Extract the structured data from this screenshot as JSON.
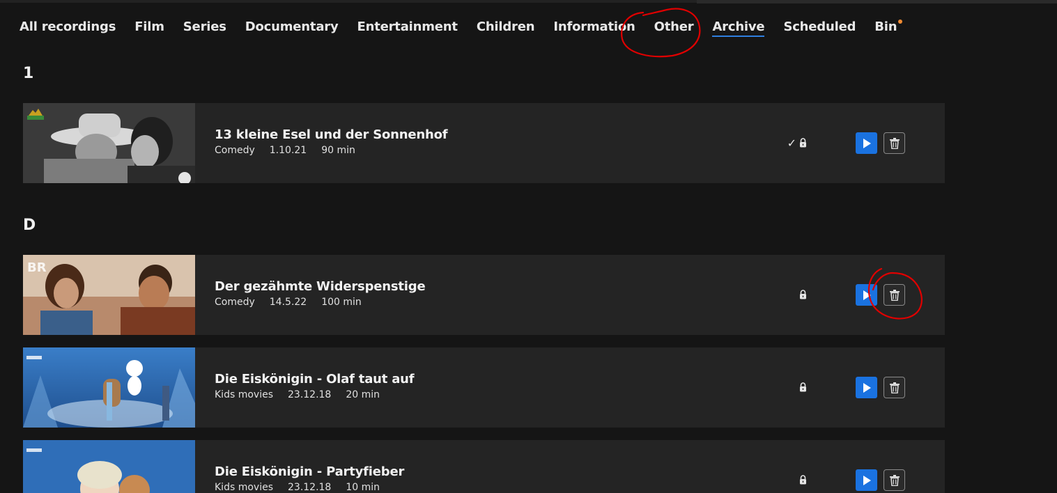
{
  "tabs": [
    {
      "label": "All recordings"
    },
    {
      "label": "Film"
    },
    {
      "label": "Series"
    },
    {
      "label": "Documentary"
    },
    {
      "label": "Entertainment"
    },
    {
      "label": "Children"
    },
    {
      "label": "Information"
    },
    {
      "label": "Other"
    },
    {
      "label": "Archive",
      "active": true
    },
    {
      "label": "Scheduled"
    },
    {
      "label": "Bin",
      "badge": true
    }
  ],
  "groups": [
    {
      "heading": "1",
      "recordings": [
        {
          "title": "13 kleine Esel und der Sonnenhof",
          "genre": "Comedy",
          "date": "1.10.21",
          "duration": "90 min",
          "check": "✓",
          "lock_icon": "lock-icon"
        }
      ]
    },
    {
      "heading": "D",
      "recordings": [
        {
          "title": "Der gezähmte Widerspenstige",
          "genre": "Comedy",
          "date": "14.5.22",
          "duration": "100 min",
          "lock_icon": "lock-icon"
        },
        {
          "title": "Die Eiskönigin - Olaf taut auf",
          "genre": "Kids movies",
          "date": "23.12.18",
          "duration": "20 min",
          "lock_icon": "lock-icon"
        },
        {
          "title": "Die Eiskönigin - Partyfieber",
          "genre": "Kids movies",
          "date": "23.12.18",
          "duration": "10 min",
          "lock_icon": "lock-icon"
        }
      ]
    }
  ],
  "colors": {
    "background": "#151515",
    "row": "#242424",
    "accent": "#1a72e0",
    "badge": "#f08a32",
    "annotation": "#e00000"
  }
}
